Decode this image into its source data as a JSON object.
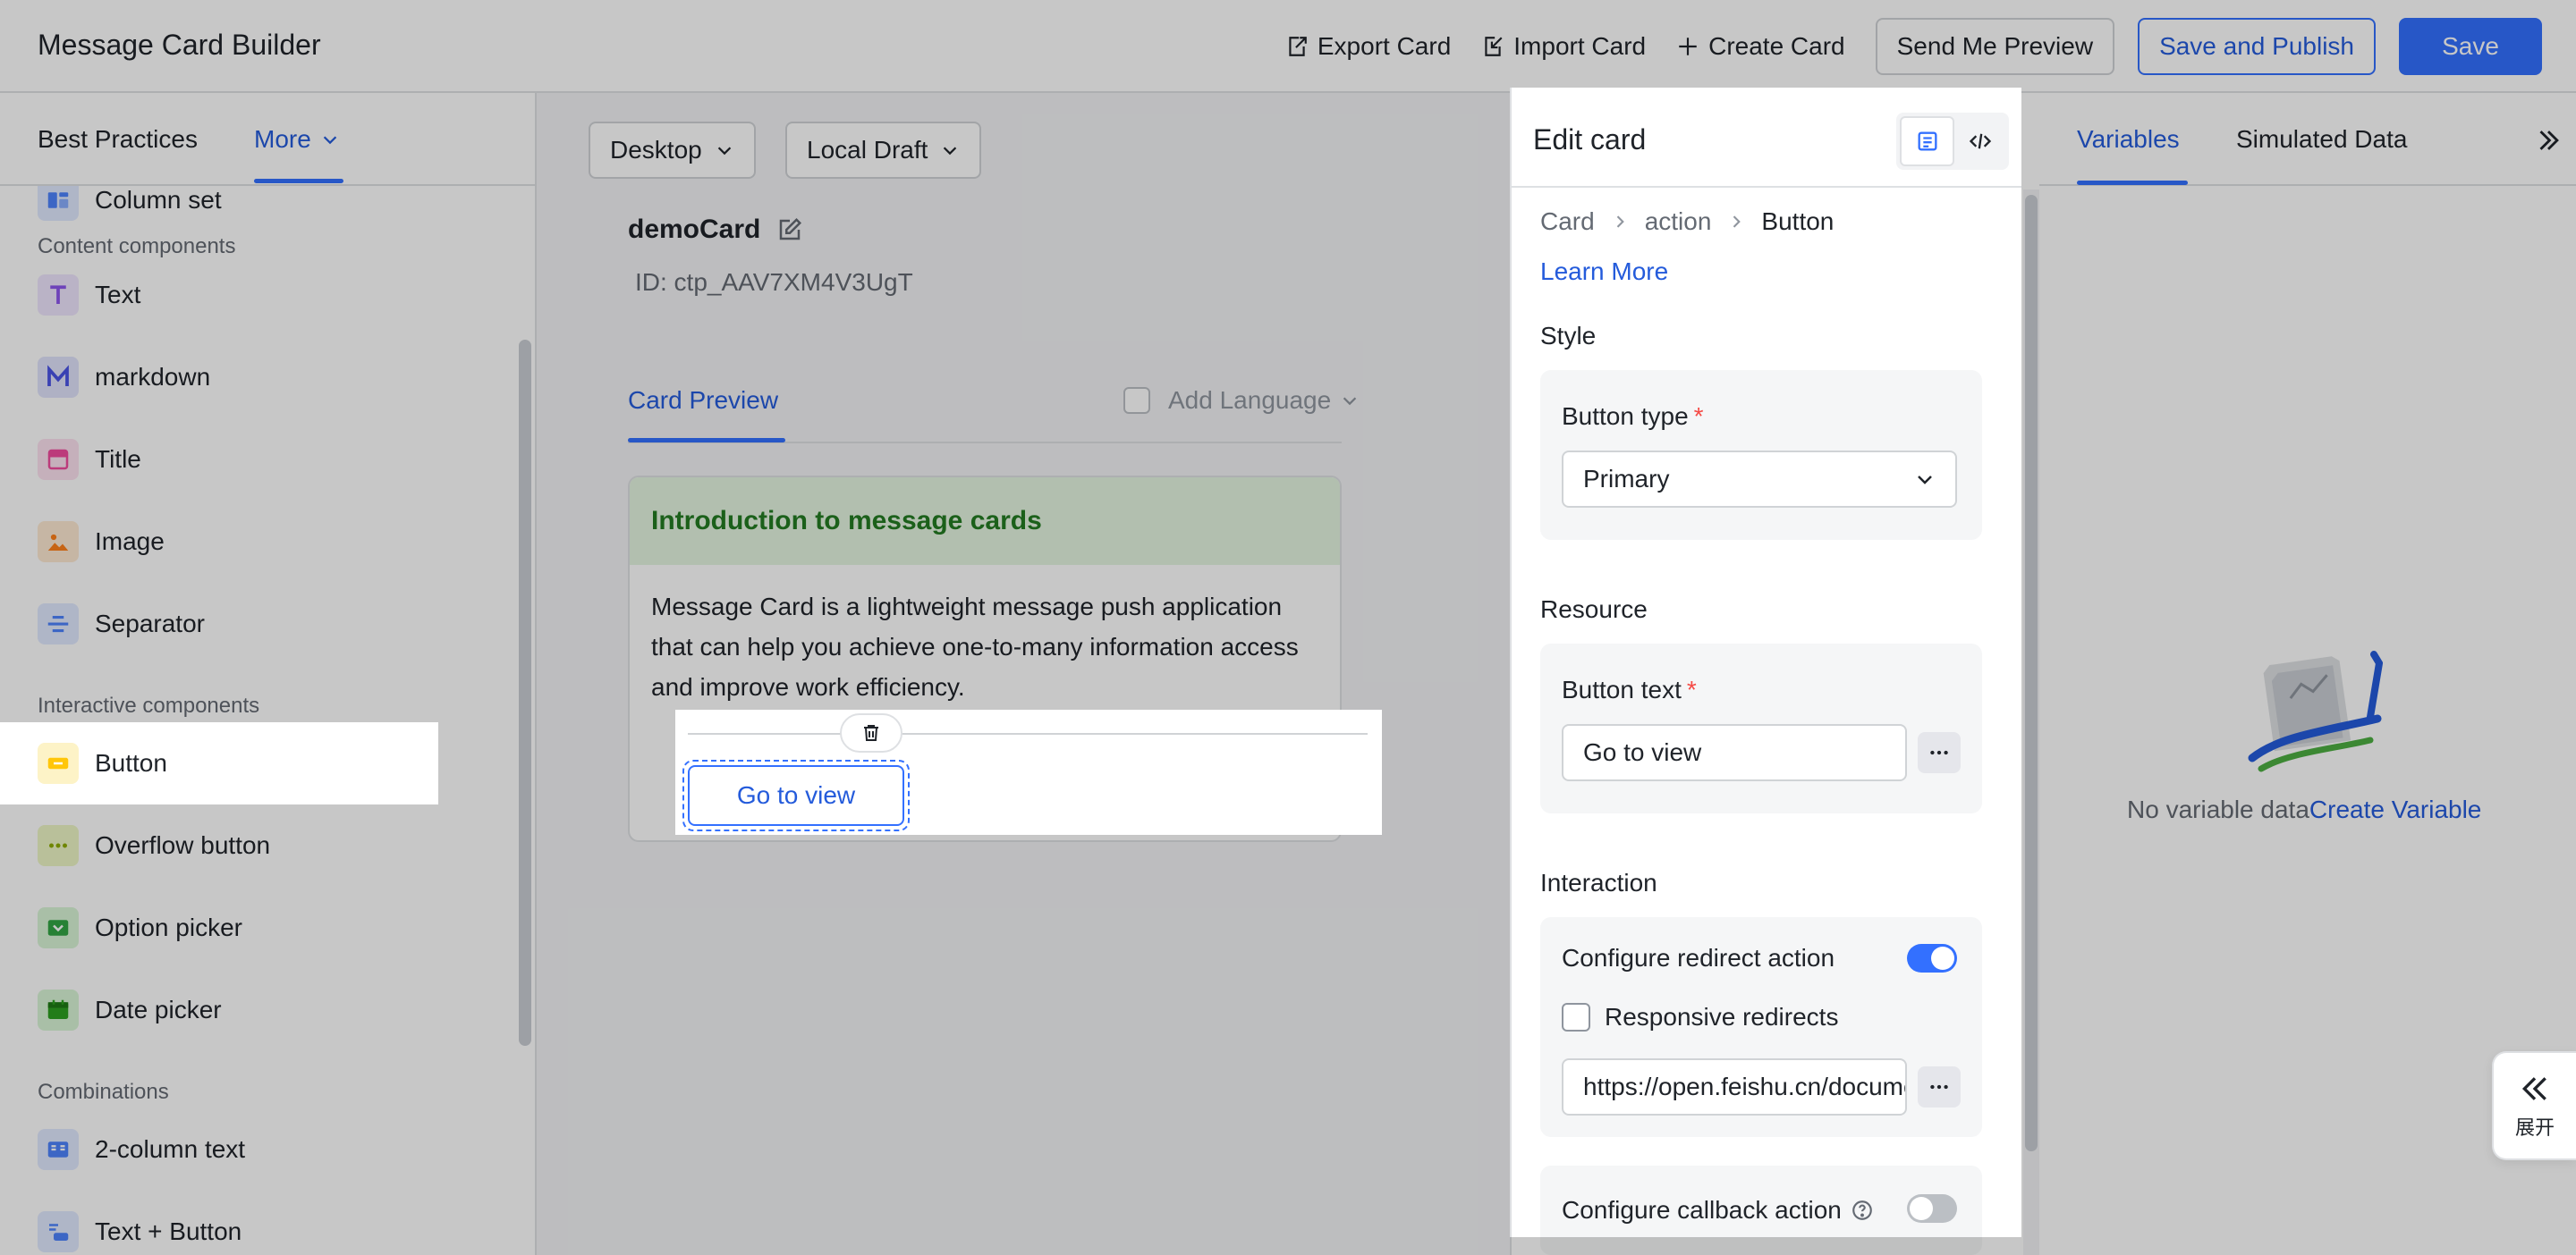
{
  "app": {
    "title": "Message Card Builder"
  },
  "toolbar": {
    "export_label": "Export Card",
    "import_label": "Import Card",
    "create_label": "Create Card",
    "send_preview_label": "Send Me Preview",
    "save_publish_label": "Save and Publish",
    "save_label": "Save"
  },
  "sidebar": {
    "tabs": [
      "Best Practices",
      "More"
    ],
    "active_tab": "More",
    "items": [
      {
        "label": "Column set",
        "icon": "column-set-icon",
        "color": "#4e83fd"
      },
      {
        "label": "Text",
        "icon": "text-icon",
        "color": "#8d55ed"
      },
      {
        "label": "markdown",
        "icon": "markdown-icon",
        "color": "#4954e6"
      },
      {
        "label": "Title",
        "icon": "title-icon",
        "color": "#f14c9e"
      },
      {
        "label": "Image",
        "icon": "image-icon",
        "color": "#ff811a"
      },
      {
        "label": "Separator",
        "icon": "separator-icon",
        "color": "#4e83fd"
      },
      {
        "label": "Button",
        "icon": "button-icon",
        "color": "#ffc60a"
      },
      {
        "label": "Overflow button",
        "icon": "overflow-button-icon",
        "color": "#8fac02"
      },
      {
        "label": "Option picker",
        "icon": "option-picker-icon",
        "color": "#32a645"
      },
      {
        "label": "Date picker",
        "icon": "date-picker-icon",
        "color": "#2ea121"
      },
      {
        "label": "2-column text",
        "icon": "two-column-text-icon",
        "color": "#4e83fd"
      },
      {
        "label": "Text + Button",
        "icon": "text-button-icon",
        "color": "#4e83fd"
      }
    ],
    "groups": [
      "Content components",
      "Interactive components",
      "Combinations"
    ],
    "selected_item": "Button"
  },
  "editor": {
    "device_select": "Desktop",
    "draft_select": "Local Draft",
    "card_name": "demoCard",
    "card_id": "ID: ctp_AAV7XM4V3UgT",
    "preview_tab": "Card Preview",
    "add_language": "Add Language",
    "card": {
      "header": "Introduction to message cards",
      "body": "Message Card is a lightweight message push application that can help you achieve one-to-many information access and improve work efficiency.",
      "button_text": "Go to view"
    }
  },
  "edit_panel": {
    "title": "Edit card",
    "breadcrumb": [
      "Card",
      "action",
      "Button"
    ],
    "learn_more": "Learn More",
    "style_section": "Style",
    "button_type_label": "Button type",
    "button_type_value": "Primary",
    "resource_section": "Resource",
    "button_text_label": "Button text",
    "button_text_value": "Go to view",
    "interaction_section": "Interaction",
    "redirect_label": "Configure redirect action",
    "redirect_enabled": true,
    "responsive_label": "Responsive redirects",
    "responsive_checked": false,
    "url_value": "https://open.feishu.cn/document",
    "callback_label": "Configure callback action",
    "callback_enabled": false,
    "required_mark": "*"
  },
  "right_panel": {
    "tabs": [
      "Variables",
      "Simulated Data"
    ],
    "active_tab": "Variables",
    "empty_text": "No variable data",
    "create_link": "Create Variable",
    "expand_label": "展开"
  },
  "colors": {
    "accent": "#3370ff",
    "link": "#245bdb",
    "card_header_bg": "#e4f5e1",
    "card_header_text": "#237c22"
  }
}
